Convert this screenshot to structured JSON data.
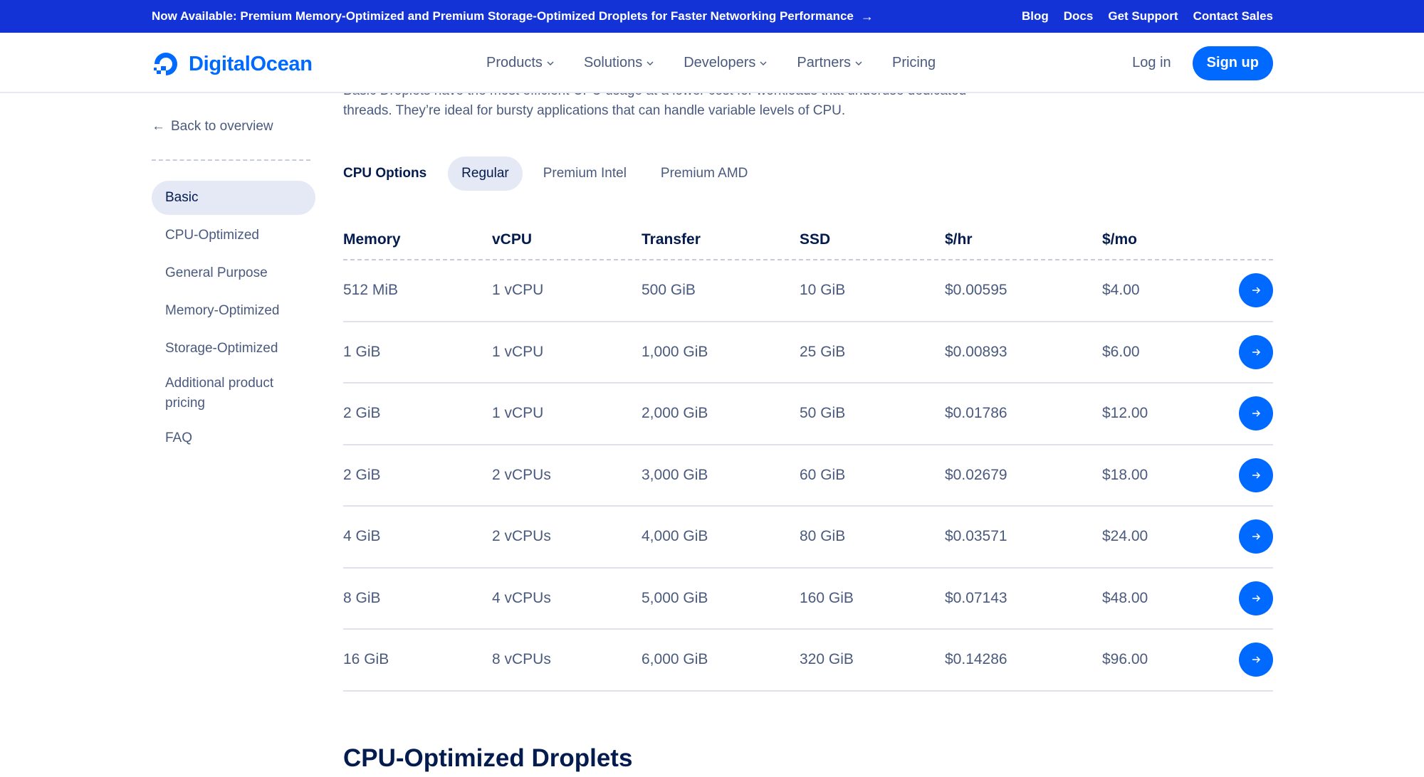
{
  "banner": {
    "message": "Now Available: Premium Memory-Optimized and Premium Storage-Optimized Droplets for Faster Networking Performance",
    "arrow_icon": "arrow-right-icon",
    "links": [
      "Blog",
      "Docs",
      "Get Support",
      "Contact Sales"
    ],
    "color": "#1433d6"
  },
  "header": {
    "logo_text": "DigitalOcean",
    "brand_color": "#0069ff",
    "nav": [
      {
        "label": "Products",
        "dropdown": true
      },
      {
        "label": "Solutions",
        "dropdown": true
      },
      {
        "label": "Developers",
        "dropdown": true
      },
      {
        "label": "Partners",
        "dropdown": true
      },
      {
        "label": "Pricing",
        "dropdown": false
      }
    ],
    "login_label": "Log in",
    "signup_label": "Sign up"
  },
  "intro": {
    "text": "Basic Droplets have the most efficient CPU usage at a lower cost for workloads that underuse dedicated threads. They’re ideal for bursty applications that can handle variable levels of CPU."
  },
  "sidebar": {
    "back_label": "Back to overview",
    "items": [
      {
        "label": "Basic",
        "active": true
      },
      {
        "label": "CPU-Optimized",
        "active": false
      },
      {
        "label": "General Purpose",
        "active": false
      },
      {
        "label": "Memory-Optimized",
        "active": false
      },
      {
        "label": "Storage-Optimized",
        "active": false
      },
      {
        "label": "Additional product pricing",
        "active": false
      },
      {
        "label": "FAQ",
        "active": false
      }
    ]
  },
  "cpu_options": {
    "label": "CPU Options",
    "tabs": [
      {
        "label": "Regular",
        "active": true
      },
      {
        "label": "Premium Intel",
        "active": false
      },
      {
        "label": "Premium AMD",
        "active": false
      }
    ]
  },
  "table": {
    "headers": [
      "Memory",
      "vCPU",
      "Transfer",
      "SSD",
      "$/hr",
      "$/mo"
    ],
    "rows": [
      [
        "512 MiB",
        "1 vCPU",
        "500 GiB",
        "10 GiB",
        "$0.00595",
        "$4.00"
      ],
      [
        "1 GiB",
        "1 vCPU",
        "1,000 GiB",
        "25 GiB",
        "$0.00893",
        "$6.00"
      ],
      [
        "2 GiB",
        "1 vCPU",
        "2,000 GiB",
        "50 GiB",
        "$0.01786",
        "$12.00"
      ],
      [
        "2 GiB",
        "2 vCPUs",
        "3,000 GiB",
        "60 GiB",
        "$0.02679",
        "$18.00"
      ],
      [
        "4 GiB",
        "2 vCPUs",
        "4,000 GiB",
        "80 GiB",
        "$0.03571",
        "$24.00"
      ],
      [
        "8 GiB",
        "4 vCPUs",
        "5,000 GiB",
        "160 GiB",
        "$0.07143",
        "$48.00"
      ],
      [
        "16 GiB",
        "8 vCPUs",
        "6,000 GiB",
        "320 GiB",
        "$0.14286",
        "$96.00"
      ]
    ],
    "row_action_icon": "arrow-right-icon"
  },
  "next_section": {
    "heading": "CPU-Optimized Droplets"
  }
}
